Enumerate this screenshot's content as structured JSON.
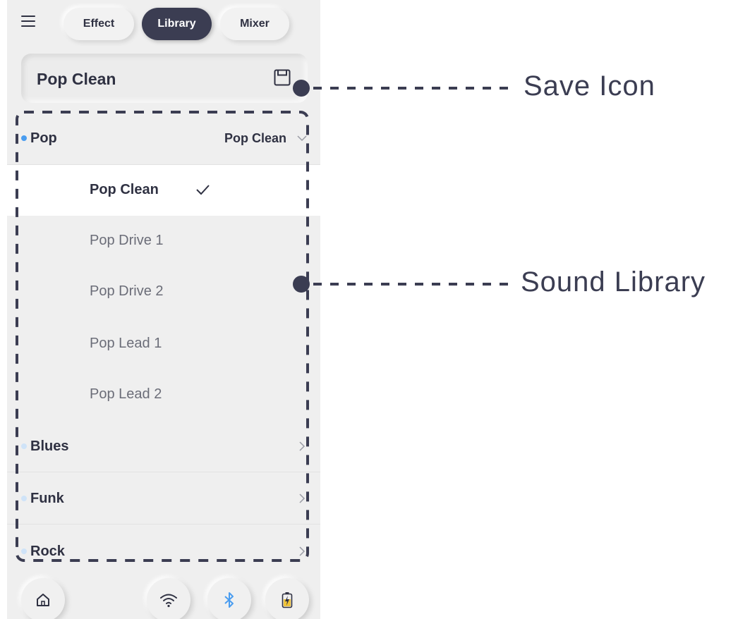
{
  "top_bar": {
    "menu_icon": "hamburger-menu-icon",
    "tabs": [
      {
        "label": "Effect",
        "active": false
      },
      {
        "label": "Library",
        "active": true
      },
      {
        "label": "Mixer",
        "active": false
      }
    ]
  },
  "preset": {
    "name": "Pop Clean",
    "save_icon": "floppy-disk-icon"
  },
  "library": {
    "pop": {
      "label": "Pop",
      "current": "Pop Clean",
      "expanded": true
    },
    "presets": [
      {
        "label": "Pop Clean",
        "selected": true
      },
      {
        "label": "Pop Drive 1",
        "selected": false
      },
      {
        "label": "Pop Drive 2",
        "selected": false
      },
      {
        "label": "Pop Lead 1",
        "selected": false
      },
      {
        "label": "Pop Lead 2",
        "selected": false
      }
    ],
    "blues": {
      "label": "Blues"
    },
    "funk": {
      "label": "Funk"
    },
    "rock": {
      "label": "Rock"
    }
  },
  "bottom_bar": {
    "icons": [
      "home-icon",
      "wifi-icon",
      "bluetooth-icon",
      "battery-charging-icon"
    ]
  },
  "annotations": {
    "save_icon_label": "Save Icon",
    "sound_library_label": "Sound Library"
  },
  "colors": {
    "accent_blue": "#4a9df0",
    "dark_navy": "#3b3d52",
    "battery_yellow": "#f0c43a"
  }
}
